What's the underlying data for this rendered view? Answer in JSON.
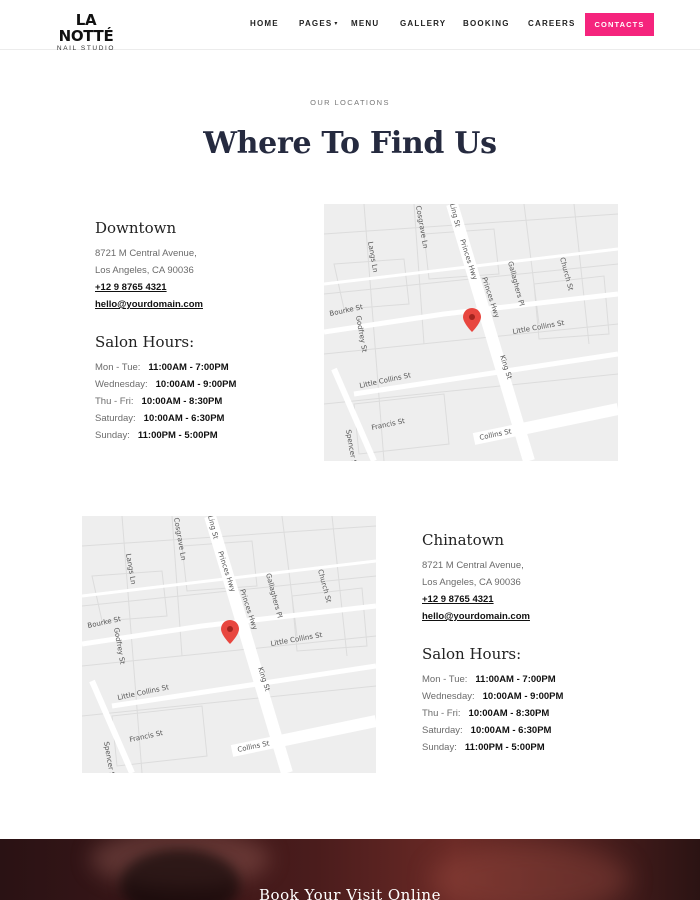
{
  "brand": {
    "name": "LA NOTTÉ",
    "tagline": "NAIL STUDIO"
  },
  "nav": {
    "items": [
      {
        "label": "HOME"
      },
      {
        "label": "PAGES",
        "has_dropdown": true
      },
      {
        "label": "MENU"
      },
      {
        "label": "GALLERY"
      },
      {
        "label": "BOOKING"
      },
      {
        "label": "CAREERS"
      }
    ],
    "cta_label": "CONTACTS"
  },
  "section": {
    "eyebrow": "OUR LOCATIONS",
    "title": "Where To Find Us"
  },
  "locations": [
    {
      "name": "Downtown",
      "address_line1": "8721 M Central Avenue,",
      "address_line2": "Los Angeles, CA 90036",
      "phone": "+12 9 8765 4321",
      "email": "hello@yourdomain.com",
      "hours_title": "Salon Hours:",
      "hours": [
        {
          "day": "Mon - Tue:",
          "time": "11:00AM - 7:00PM"
        },
        {
          "day": "Wednesday:",
          "time": "10:00AM - 9:00PM"
        },
        {
          "day": "Thu - Fri:",
          "time": "10:00AM - 8:30PM"
        },
        {
          "day": "Saturday:",
          "time": "10:00AM - 6:30PM"
        },
        {
          "day": "Sunday:",
          "time": "11:00PM - 5:00PM"
        }
      ]
    },
    {
      "name": "Chinatown",
      "address_line1": "8721 M Central Avenue,",
      "address_line2": "Los Angeles, CA 90036",
      "phone": "+12 9 8765 4321",
      "email": "hello@yourdomain.com",
      "hours_title": "Salon Hours:",
      "hours": [
        {
          "day": "Mon - Tue:",
          "time": "11:00AM - 7:00PM"
        },
        {
          "day": "Wednesday:",
          "time": "10:00AM - 9:00PM"
        },
        {
          "day": "Thu - Fri:",
          "time": "10:00AM - 8:30PM"
        },
        {
          "day": "Saturday:",
          "time": "10:00AM - 6:30PM"
        },
        {
          "day": "Sunday:",
          "time": "11:00PM - 5:00PM"
        }
      ]
    }
  ],
  "map": {
    "street_labels": [
      "Langs Ln",
      "Cosgrave Ln",
      "Princes Hwy",
      "Gallaghers Pl",
      "Church St",
      "Bourke St",
      "Godfrey St",
      "Little Collins St",
      "Princes Hwy",
      "King St",
      "Little Collins St",
      "Francis St",
      "Collins St",
      "Spencer St",
      "Ling St"
    ],
    "marker_icon": "map-pin-icon",
    "marker_color": "#e8463f"
  },
  "banner": {
    "title": "Book Your Visit Online"
  },
  "colors": {
    "accent": "#f5247d",
    "heading": "#252a3f"
  }
}
